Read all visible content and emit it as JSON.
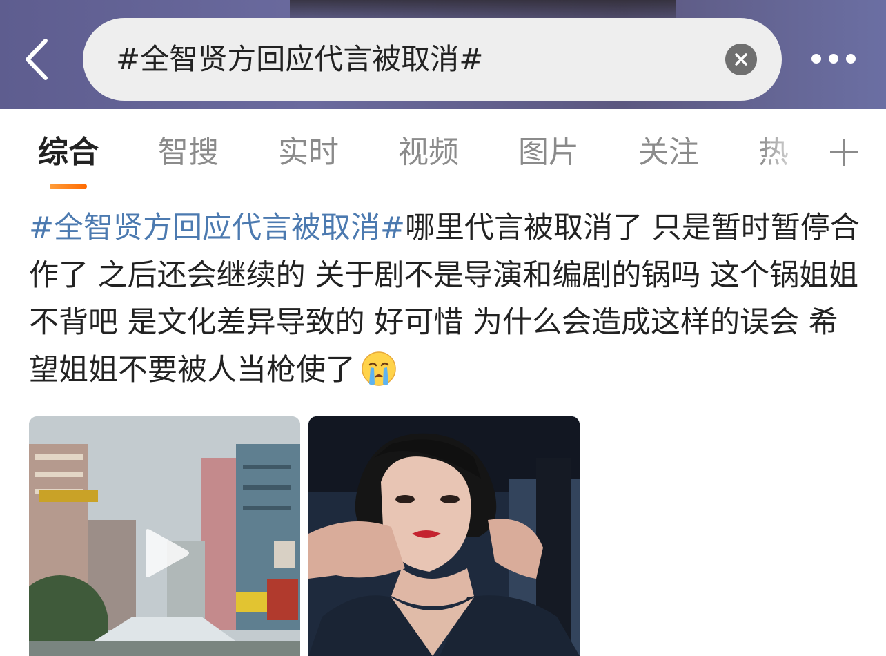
{
  "header": {
    "search_query": "#全智贤方回应代言被取消#"
  },
  "tabs": [
    {
      "label": "综合",
      "active": true
    },
    {
      "label": "智搜"
    },
    {
      "label": "实时"
    },
    {
      "label": "视频"
    },
    {
      "label": "图片"
    },
    {
      "label": "关注"
    },
    {
      "label": "热"
    }
  ],
  "post": {
    "hashtag": "#全智贤方回应代言被取消#",
    "text": "哪里代言被取消了 只是暂时暂停合作了 之后还会继续的 关于剧不是导演和编剧的锅吗 这个锅姐姐不背吧 是文化差异导致的 好可惜 为什么会造成这样的误会 希望姐姐不要被人当枪使了",
    "emoji": "crying-face-icon"
  },
  "media": [
    {
      "type": "video",
      "icon": "play-icon"
    },
    {
      "type": "image"
    }
  ],
  "colors": {
    "hashtag": "#4c7ab0",
    "tab_active_underline": "#ff6a00",
    "header_bg": "#5e5d8f"
  }
}
